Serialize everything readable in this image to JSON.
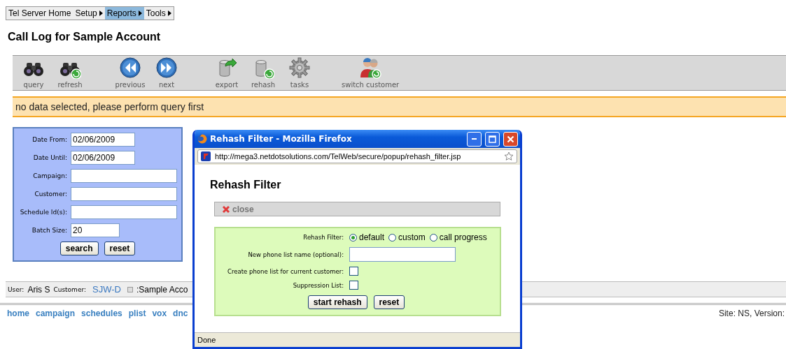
{
  "menu": [
    {
      "label": "Tel Server Home",
      "selected": false,
      "submenu": false
    },
    {
      "label": "Setup",
      "selected": false,
      "submenu": true
    },
    {
      "label": "Reports",
      "selected": true,
      "submenu": true
    },
    {
      "label": "Tools",
      "selected": false,
      "submenu": true
    }
  ],
  "page_title": "Call Log for Sample Account",
  "toolbar_groups": [
    [
      {
        "label": "query",
        "kind": "binoculars"
      },
      {
        "label": "refresh",
        "kind": "binoculars-refresh"
      }
    ],
    [
      {
        "label": "previous",
        "kind": "rewind"
      },
      {
        "label": "next",
        "kind": "forward"
      }
    ],
    [
      {
        "label": "export",
        "kind": "db-export"
      },
      {
        "label": "rehash",
        "kind": "db-refresh"
      },
      {
        "label": "tasks",
        "kind": "gear"
      }
    ],
    [
      {
        "label": "switch customer",
        "kind": "users"
      }
    ]
  ],
  "alert": "no data selected, please perform query first",
  "search_form": {
    "fields": [
      {
        "label": "Date From:",
        "kind": "date",
        "value": "02/06/2009"
      },
      {
        "label": "Date Until:",
        "kind": "date",
        "value": "02/06/2009"
      },
      {
        "label": "Campaign:",
        "kind": "text"
      },
      {
        "label": "Customer:",
        "kind": "text"
      },
      {
        "label": "Schedule Id(s):",
        "kind": "text"
      },
      {
        "label": "Batch Size:",
        "kind": "number",
        "value": "20"
      }
    ],
    "buttons": [
      "search",
      "reset"
    ]
  },
  "status_bar": {
    "user_label": "User:",
    "user": "Aris S",
    "customer_label": "Customer:",
    "customer": "SJW-D",
    "account": ":Sample Acco"
  },
  "nav_links": [
    "home",
    "campaign",
    "schedules",
    "plist",
    "vox",
    "dnc"
  ],
  "site_info": "Site: NS, Version:",
  "popup": {
    "title": "Rehash Filter - Mozilla Firefox",
    "url": "http://mega3.netdotsolutions.com/TelWeb/secure/popup/rehash_filter.jsp",
    "heading": "Rehash Filter",
    "close": "close",
    "rows": [
      {
        "kind": "radio",
        "label": "Rehash Filter:",
        "options": [
          {
            "label": "default",
            "selected": true
          },
          {
            "label": "custom",
            "selected": false
          },
          {
            "label": "call progress",
            "selected": false
          }
        ]
      },
      {
        "kind": "text",
        "label": "New phone list name (optional):"
      },
      {
        "kind": "checkbox",
        "label": "Create phone list for current customer:",
        "checked": false
      },
      {
        "kind": "checkbox",
        "label": "Suppression List:",
        "checked": false
      }
    ],
    "buttons": [
      "start rehash",
      "reset"
    ],
    "status": "Done"
  }
}
